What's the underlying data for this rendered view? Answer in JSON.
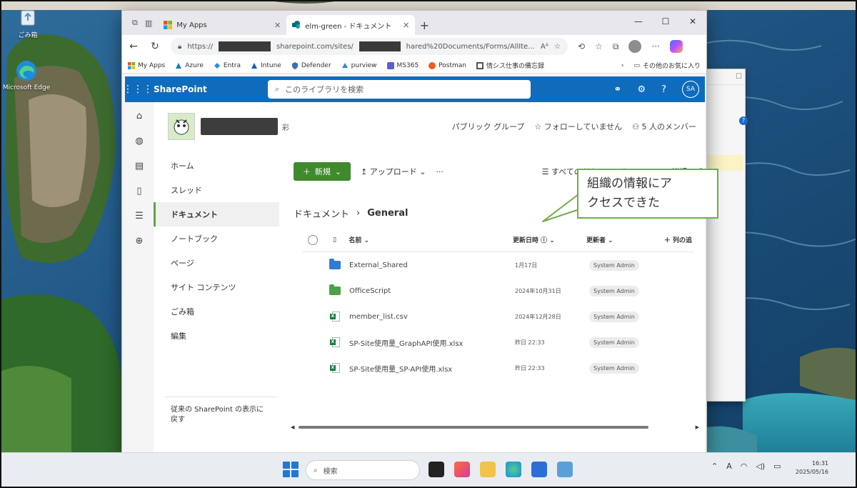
{
  "desktop": {
    "icons": [
      {
        "label": "ごみ箱",
        "icon": "recycle-bin-icon"
      },
      {
        "label": "Microsoft Edge",
        "icon": "edge-icon"
      }
    ]
  },
  "browser": {
    "tabs": [
      {
        "title": "My Apps",
        "icon": "microsoft-logo-icon",
        "active": false
      },
      {
        "title": "elm-green - ドキュメント",
        "icon": "sharepoint-icon",
        "active": true
      }
    ],
    "address": {
      "prefix": "https://",
      "part1": "sharepoint.com/sites/",
      "part2": "hared%20Documents/Forms/AllIte...",
      "reader": "Aᴬ"
    },
    "favorites": [
      {
        "label": "My Apps",
        "icon": "microsoft-logo-icon"
      },
      {
        "label": "Azure",
        "icon": "azure-icon"
      },
      {
        "label": "Entra",
        "icon": "entra-icon"
      },
      {
        "label": "Intune",
        "icon": "intune-icon"
      },
      {
        "label": "Defender",
        "icon": "defender-icon"
      },
      {
        "label": "purview",
        "icon": "purview-icon"
      },
      {
        "label": "MS365",
        "icon": "ms365-icon"
      },
      {
        "label": "Postman",
        "icon": "postman-icon"
      },
      {
        "label": "情シス仕事の備忘録",
        "icon": "blog-icon"
      }
    ],
    "other_favorites": "その他のお気に入り"
  },
  "sharepoint": {
    "app_name": "SharePoint",
    "search_placeholder": "このライブラリを検索",
    "user_initials": "SA",
    "site": {
      "suffix": "彩",
      "visibility": "パブリック グループ",
      "follow": "フォローしていません",
      "members": "5 人のメンバー"
    },
    "nav": [
      {
        "label": "ホーム",
        "selected": false
      },
      {
        "label": "スレッド",
        "selected": false
      },
      {
        "label": "ドキュメント",
        "selected": true
      },
      {
        "label": "ノートブック",
        "selected": false
      },
      {
        "label": "ページ",
        "selected": false
      },
      {
        "label": "サイト コンテンツ",
        "selected": false
      },
      {
        "label": "ごみ箱",
        "selected": false
      },
      {
        "label": "編集",
        "selected": false
      }
    ],
    "return_link": "従来の SharePoint の表示に戻す",
    "commands": {
      "new": "新規",
      "upload": "アップロード",
      "more": "···",
      "view": "すべてのドキュメント",
      "details": "詳細"
    },
    "breadcrumb": {
      "parent": "ドキュメント",
      "current": "General"
    },
    "columns": {
      "name": "名前",
      "modified": "更新日時",
      "modified_by": "更新者",
      "add": "列の追"
    },
    "files": [
      {
        "name": "External_Shared",
        "type": "folder",
        "color": "#2f7bd8",
        "modified": "1月17日",
        "by": "System Admin"
      },
      {
        "name": "OfficeScript",
        "type": "folder",
        "color": "#4aa244",
        "modified": "2024年10月31日",
        "by": "System Admin"
      },
      {
        "name": "member_list.csv",
        "type": "csv",
        "modified": "2024年12月28日",
        "by": "System Admin"
      },
      {
        "name": "SP-Site使用量_GraphAPI使用.xlsx",
        "type": "xlsx",
        "modified": "昨日 22:33",
        "by": "System Admin"
      },
      {
        "name": "SP-Site使用量_SP-API使用.xlsx",
        "type": "xlsx",
        "modified": "昨日 22:33",
        "by": "System Admin"
      }
    ]
  },
  "callout": {
    "line1": "組織の情報にア",
    "line2": "クセスできた"
  },
  "taskbar": {
    "search_placeholder": "検索",
    "clock_time": "16:31",
    "clock_date": "2025/05/16",
    "ime": "A"
  },
  "colors": {
    "suite_bar": "#0f6cbd",
    "new_button": "#3f8a2c",
    "callout_border": "#70ad47"
  }
}
